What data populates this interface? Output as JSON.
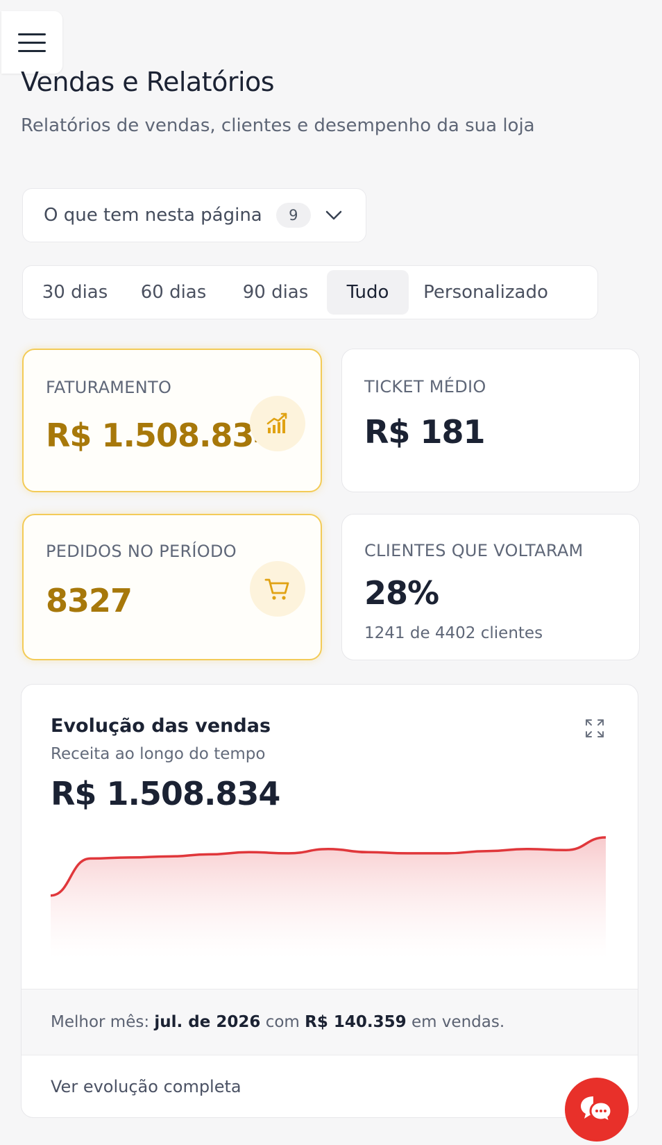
{
  "header": {
    "title": "Vendas e Relatórios",
    "subtitle": "Relatórios de vendas, clientes e desempenho da sua loja"
  },
  "toc": {
    "label": "O que tem nesta página",
    "count": "9"
  },
  "tabs": [
    {
      "label": "30 dias",
      "active": false
    },
    {
      "label": "60 dias",
      "active": false
    },
    {
      "label": "90 dias",
      "active": false
    },
    {
      "label": "Tudo",
      "active": true
    },
    {
      "label": "Personalizado",
      "active": false
    }
  ],
  "kpis": {
    "revenue": {
      "label": "FATURAMENTO",
      "value": "R$ 1.508.834",
      "icon": "chart-bar-up-icon"
    },
    "ticket": {
      "label": "TICKET MÉDIO",
      "value": "R$ 181"
    },
    "orders": {
      "label": "PEDIDOS NO PERÍODO",
      "value": "8327",
      "icon": "cart-icon"
    },
    "returning": {
      "label": "CLIENTES QUE VOLTARAM",
      "value": "28%",
      "sub": "1241 de 4402 clientes"
    }
  },
  "evolution": {
    "title": "Evolução das vendas",
    "subtitle": "Receita ao longo do tempo",
    "total": "R$ 1.508.834",
    "best_prefix": "Melhor mês:",
    "best_month": "jul. de 2026",
    "best_mid": "com",
    "best_value": "R$ 140.359",
    "best_suffix": "em vendas.",
    "link": "Ver evolução completa"
  },
  "colors": {
    "accent": "#a7780a",
    "highlight_border": "#f3cb57",
    "line": "#e0373b",
    "fab": "#e8302a"
  },
  "chart_data": {
    "type": "area",
    "values": [
      60,
      95,
      96,
      97,
      99,
      101,
      100,
      104,
      101,
      100,
      100,
      102,
      104,
      103,
      115
    ],
    "color": "#e0373b"
  }
}
